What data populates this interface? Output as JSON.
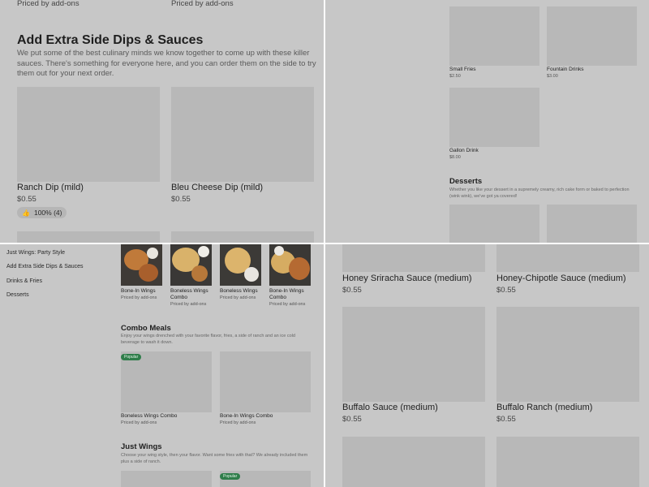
{
  "q1": {
    "top_prices": [
      "Priced by add-ons",
      "Priced by add-ons"
    ],
    "section_title": "Add Extra Side Dips & Sauces",
    "section_desc": "We put some of the best culinary minds we know together to come up with these killer sauces. There's something for everyone here, and you can order them on the side to try them out for your next order.",
    "items": [
      {
        "name": "Ranch Dip (mild)",
        "price": "$0.55"
      },
      {
        "name": "Bleu Cheese Dip (mild)",
        "price": "$0.55"
      }
    ],
    "rating": {
      "icon": "thumbs-up-icon",
      "text": "100% (4)"
    }
  },
  "q2": {
    "items": [
      {
        "name": "Small Fries",
        "price": "$2.50"
      },
      {
        "name": "Fountain Drinks",
        "price": "$3.00"
      },
      {
        "name": "Gallon Drink",
        "price": "$8.00"
      }
    ],
    "desserts": {
      "title": "Desserts",
      "desc": "Whether you like your dessert in a supremely creamy, rich cake form or baked to perfection (wink wink), we've got ya covered!"
    }
  },
  "q3": {
    "nav": [
      "Just Wings: Party Style",
      "Add Extra Side Dips & Sauces",
      "Drinks & Fries",
      "Desserts"
    ],
    "top_items": [
      {
        "name": "Bone-In Wings",
        "price": "Priced by add-ons"
      },
      {
        "name": "Boneless Wings Combo",
        "price": "Priced by add-ons"
      },
      {
        "name": "Boneless Wings",
        "price": "Priced by add-ons"
      },
      {
        "name": "Bone-In Wings Combo",
        "price": "Priced by add-ons"
      }
    ],
    "combo": {
      "title": "Combo Meals",
      "desc": "Enjoy your wings drenched with your favorite flavor, fries, a side of ranch and an ice cold beverage to wash it down.",
      "badge": "Popular",
      "items": [
        {
          "name": "Boneless Wings Combo",
          "price": "Priced by add-ons"
        },
        {
          "name": "Bone-In Wings Combo",
          "price": "Priced by add-ons"
        }
      ]
    },
    "just_wings": {
      "title": "Just Wings",
      "desc": "Choose your wing style, then your flavor. Want some fries with that? We already included them plus a side of ranch.",
      "badge": "Popular"
    }
  },
  "q4": {
    "items": [
      {
        "name": "Honey Sriracha Sauce (medium)",
        "price": "$0.55"
      },
      {
        "name": "Honey-Chipotle Sauce (medium)",
        "price": "$0.55"
      },
      {
        "name": "Buffalo Sauce (medium)",
        "price": "$0.55"
      },
      {
        "name": "Buffalo Ranch (medium)",
        "price": "$0.55"
      }
    ]
  },
  "colors": {
    "background": "#c7c7c7",
    "placeholder": "#b8b8b8",
    "badge": "#2f7d4a",
    "divider": "#ffffff"
  }
}
